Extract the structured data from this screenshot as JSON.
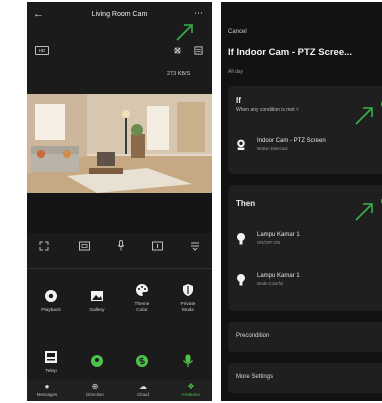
{
  "left": {
    "title": "Living Room Cam",
    "hd_label": "HD",
    "speed": "273 KB/S",
    "features": [
      {
        "label": "Playback",
        "icon": "playback-icon"
      },
      {
        "label": "Gallery",
        "icon": "gallery-icon"
      },
      {
        "label": "Theme Color",
        "icon": "palette-icon"
      },
      {
        "label": "Private Mode",
        "icon": "privacy-icon"
      },
      {
        "label": "Telep",
        "icon": "telephone-icon"
      }
    ],
    "tabs": [
      {
        "label": "Messages",
        "icon": "bell-icon"
      },
      {
        "label": "Direction",
        "icon": "direction-icon"
      },
      {
        "label": "Cloud",
        "icon": "cloud-icon"
      },
      {
        "label": "Features",
        "icon": "features-icon",
        "active": true
      }
    ],
    "accent": "#4cc24a"
  },
  "right": {
    "cancel": "Cancel",
    "title": "If Indoor Cam - PTZ Scree...",
    "schedule": "All day",
    "if_card": {
      "heading": "If",
      "condition_mode": "When any condition is met",
      "device": {
        "name": "Indoor Cam - PTZ Screen",
        "status": "Motion Detected"
      }
    },
    "then_card": {
      "heading": "Then",
      "actions": [
        {
          "name": "Lampu Kamar 1",
          "status": "ON/OFF:ON"
        },
        {
          "name": "Lampu Kamar 1",
          "status": "Mode:Colorful"
        }
      ]
    },
    "precondition": "Precondition",
    "more_settings": "More Settings"
  }
}
